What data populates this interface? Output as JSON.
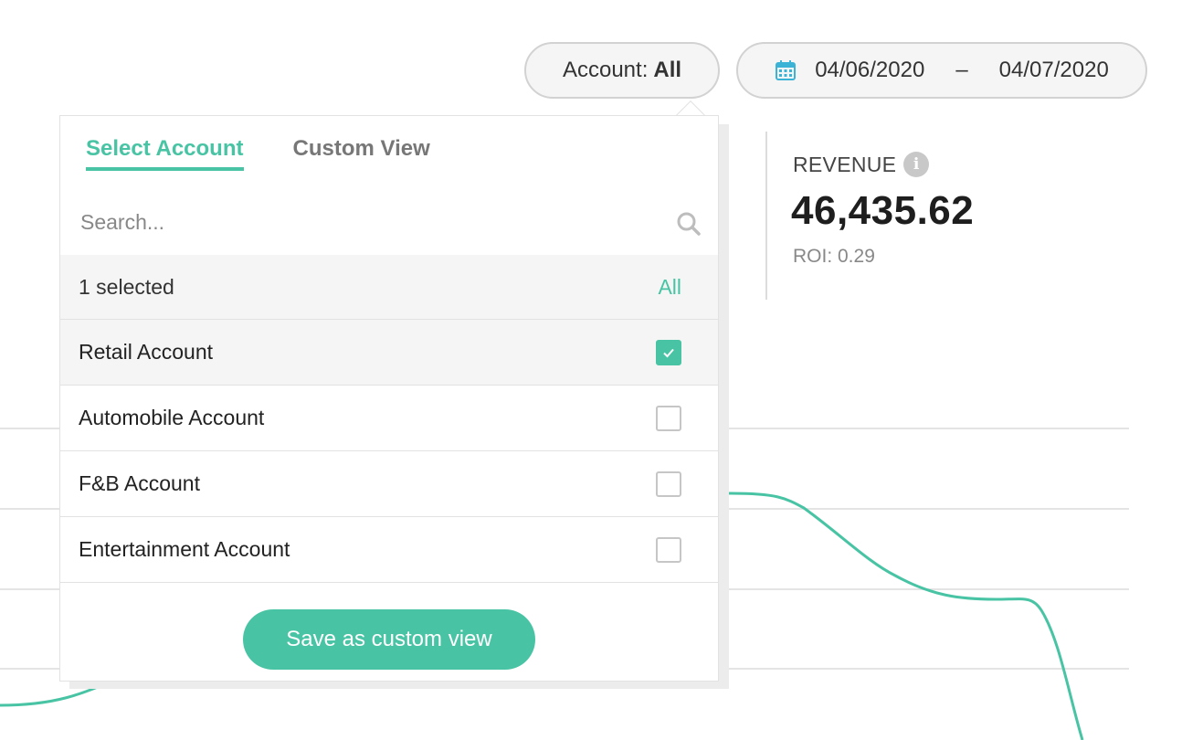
{
  "filters": {
    "account_label": "Account:",
    "account_value": "All",
    "date_start": "04/06/2020",
    "date_separator": "–",
    "date_end": "04/07/2020"
  },
  "metric": {
    "label": "REVENUE",
    "value": "46,435.62",
    "roi": "ROI: 0.29"
  },
  "dropdown": {
    "tabs": [
      {
        "label": "Select Account",
        "active": true
      },
      {
        "label": "Custom View",
        "active": false
      }
    ],
    "search": {
      "placeholder": "Search...",
      "value": ""
    },
    "selected_count": "1 selected",
    "select_all_label": "All",
    "accounts": [
      {
        "label": "Retail Account",
        "checked": true
      },
      {
        "label": "Automobile Account",
        "checked": false
      },
      {
        "label": "F&B Account",
        "checked": false
      },
      {
        "label": "Entertainment Account",
        "checked": false
      }
    ],
    "save_label": "Save as custom view"
  },
  "icons": [
    "calendar-icon",
    "info-icon",
    "search-icon",
    "checkmark-icon"
  ],
  "colors": {
    "accent": "#48c4a4",
    "calendar": "#3bb3d6"
  }
}
